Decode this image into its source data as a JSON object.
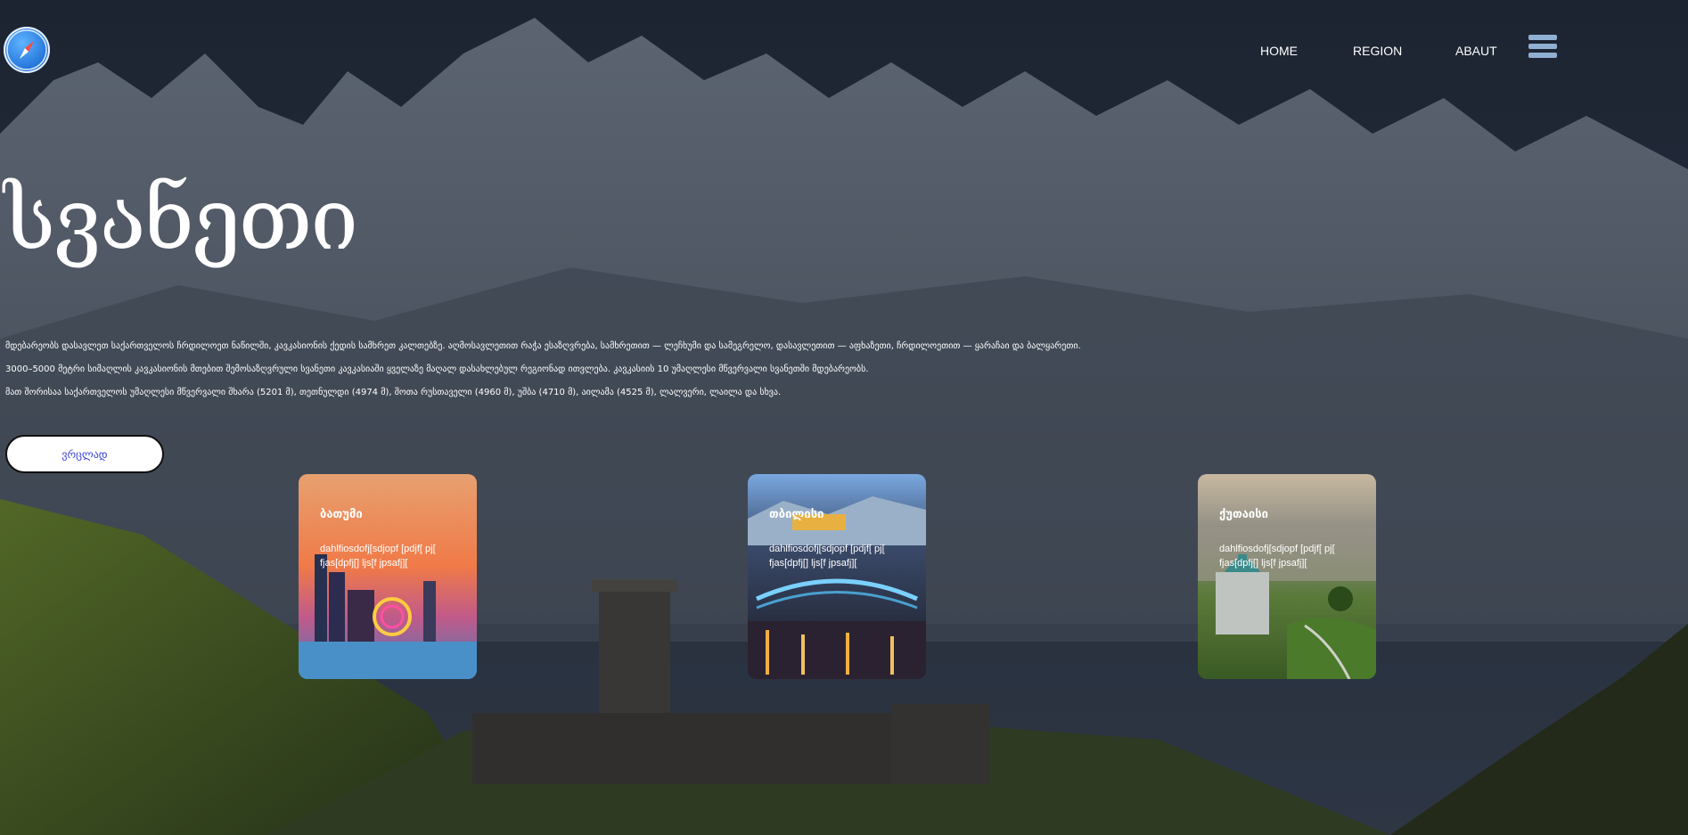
{
  "nav": {
    "home": "HOME",
    "region": "REGION",
    "about": "ABAUT"
  },
  "hero": {
    "title": "სვანეთი",
    "lines": [
      "მდებარეობს დასავლეთ საქართველოს ჩრდილოეთ ნაწილში, კავკასიონის ქედის სამხრეთ კალთებზე. აღმოსავლეთით რაჭა ესაზღვრება, სამხრეთით — ლეჩხუმი და სამეგრელო, დასავლეთით — აფხაზეთი, ჩრდილოეთით — ყარაჩაი და ბალყარეთი.",
      "3000–5000 მეტრი სიმაღლის კავკასიონის მთებით შემოსაზღვრული სვანეთი კავკასიაში ყველაზე მაღალ დასახლებულ რეგიონად ითვლება. კავკასიის 10 უმაღლესი მწვერვალი სვანეთში მდებარეობს.",
      "მათ შორისაა საქართველოს უმაღლესი მწვერვალი შხარა (5201 მ), თეთნულდი (4974 მ), შოთა რუსთაველი (4960 მ), უშბა (4710 მ), აილამა (4525 მ), ლალვერი, ლაილა და სხვა."
    ],
    "button": "ვრცლად"
  },
  "cards": [
    {
      "title": "ბათუმი",
      "text": "dahlfiosdofj[sdjopf [pdjf[ pj[ fjas[dpfj[] ljs[f jpsafj]["
    },
    {
      "title": "თბილისი",
      "text": "dahlfiosdofj[sdjopf [pdjf[ pj[ fjas[dpfj[] ljs[f jpsafj]["
    },
    {
      "title": "ქუთაისი",
      "text": "dahlfiosdofj[sdjopf [pdjf[ pj[ fjas[dpfj[] ljs[f jpsafj]["
    }
  ],
  "colors": {
    "button_text": "#3a40d8",
    "burger": "#8fb0d2",
    "logo": "#1f6fd6"
  },
  "icons": {
    "logo": "compass-icon",
    "menu": "hamburger-menu-icon"
  }
}
